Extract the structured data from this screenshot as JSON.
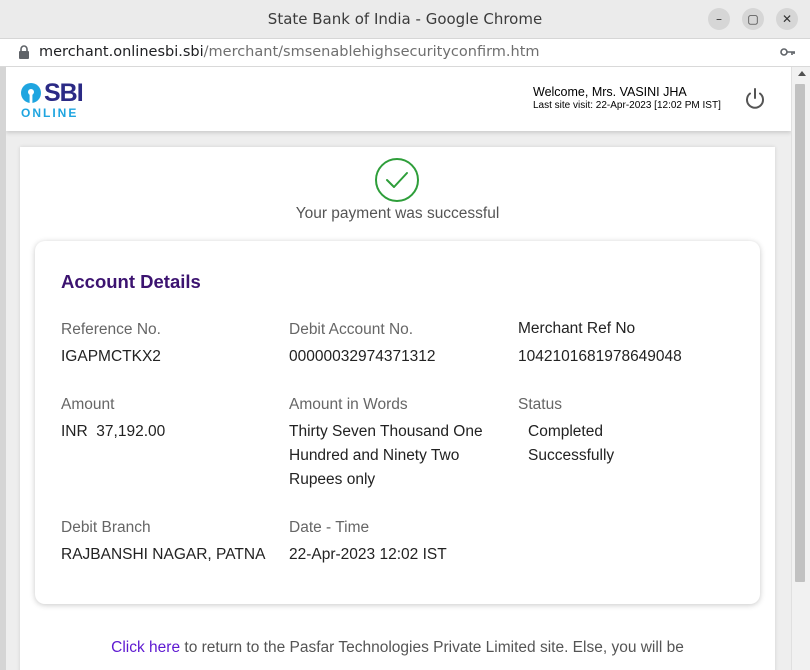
{
  "window": {
    "title": "State Bank of India - Google Chrome",
    "url_host": "merchant.onlinesbi.sbi",
    "url_path": "/merchant/smsenablehighsecurityconfirm.htm"
  },
  "header": {
    "logo_main": "SBI",
    "logo_sub": "ONLINE",
    "welcome": "Welcome, Mrs. VASINI JHA",
    "last_visit": "Last site visit: 22-Apr-2023 [12:02 PM IST]"
  },
  "payment": {
    "message": "Your payment was successful"
  },
  "account": {
    "title": "Account Details",
    "reference_label": "Reference No.",
    "reference_value": "IGAPMCTKX2",
    "debit_account_label": "Debit Account No.",
    "debit_account_value": "00000032974371312",
    "merchant_ref_label": "Merchant Ref No",
    "merchant_ref_value": "104210168197864904​8",
    "amount_label": "Amount",
    "amount_value": "INR  37,192.00",
    "amount_words_label": "Amount in Words",
    "amount_words_lines": [
      "Thirty Seven Thousand One",
      "Hundred and Ninety Two",
      "Rupees only"
    ],
    "status_label": "Status",
    "status_lines": [
      "Completed",
      "Successfully"
    ],
    "branch_label": "Debit Branch",
    "branch_value": "RAJBANSHI NAGAR, PATNA",
    "datetime_label": "Date - Time",
    "datetime_value": "22-Apr-2023 12:02 IST"
  },
  "footer": {
    "link_text": "Click here",
    "text": " to return to the Pasfar Technologies Private Limited site. Else, you will be"
  },
  "colors": {
    "brand_purple": "#3c1370",
    "success_green": "#2e9e3a",
    "link": "#5d18d1"
  }
}
